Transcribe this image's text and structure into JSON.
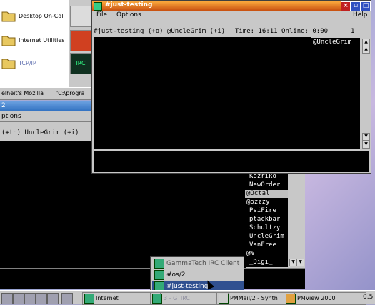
{
  "desktop": {
    "folder_items": [
      {
        "label": "Desktop On-Call",
        "icon": "folder-icon"
      },
      {
        "label": "Internet Utilities",
        "icon": "folder-icon"
      },
      {
        "label": "TCP/IP",
        "icon": "folder-icon"
      }
    ],
    "big_icons": [
      {
        "icon": "document-icon"
      },
      {
        "icon": "mozilla-icon"
      },
      {
        "icon": "irc-icon",
        "label": "IRC"
      }
    ],
    "mozilla_bar": {
      "left": "elheit's Mozilla",
      "right": "\"C:\\progra"
    }
  },
  "back_window": {
    "title": "2",
    "menu_label": "ptions",
    "status": "(+tn) UncleGrim (+i)",
    "nicks": [
      {
        "name": "Kozriko",
        "selected": false
      },
      {
        "name": "NewOrder",
        "selected": false
      },
      {
        "name": "@Octal",
        "selected": true
      },
      {
        "name": "@ozzzy",
        "selected": false
      },
      {
        "name": "PsiFire",
        "selected": false
      },
      {
        "name": "ptackbar",
        "selected": false
      },
      {
        "name": "Schultzy",
        "selected": false
      },
      {
        "name": "UncleGrim",
        "selected": false
      },
      {
        "name": "VanFree",
        "selected": false
      },
      {
        "name": "@%",
        "selected": false
      },
      {
        "name": "_Digi_",
        "selected": false
      }
    ]
  },
  "front_window": {
    "title": "#just-testing",
    "menu": {
      "file": "File",
      "options": "Options",
      "help": "Help"
    },
    "status": {
      "channel": "#just-testing (+o) @UncleGrim (+i)",
      "time": "Time: 16:11 Online: 0:00",
      "count": "1"
    },
    "nick_list": [
      "@UncleGrim"
    ]
  },
  "popup": {
    "items": [
      {
        "label": "GammaTech IRC Client",
        "highlighted": false
      },
      {
        "label": "#os/2",
        "highlighted": false
      },
      {
        "label": "#just-testing",
        "highlighted": true
      }
    ]
  },
  "taskbar": {
    "buttons": [
      {
        "label": "Internet"
      },
      {
        "label": "3 - GTIRC"
      },
      {
        "label": "PMMail/2 - Synth"
      },
      {
        "label": "PMView 2000"
      }
    ],
    "clock": "0.5"
  },
  "colors": {
    "active_title": "#e07020",
    "inactive_title": "#3070c0",
    "highlight": "#305090"
  }
}
